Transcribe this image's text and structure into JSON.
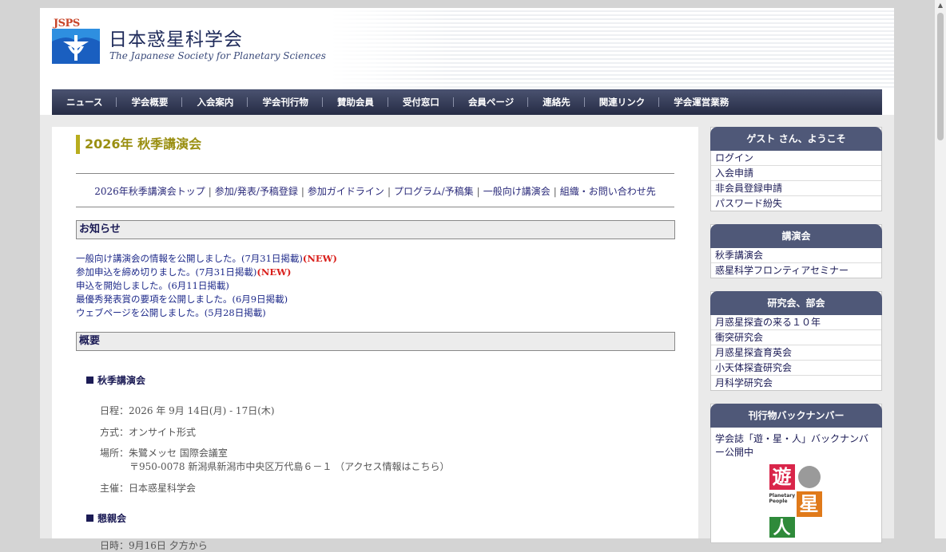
{
  "site": {
    "logo_jsps": "JSPS",
    "title": "日本惑星科学会",
    "subtitle": "The Japanese Society for Planetary Sciences"
  },
  "nav": [
    "ニュース",
    "学会概要",
    "入会案内",
    "学会刊行物",
    "賛助会員",
    "受付窓口",
    "会員ページ",
    "連絡先",
    "関連リンク",
    "学会運営業務"
  ],
  "main": {
    "title": "2026年 秋季講演会",
    "subnav": [
      "2026年秋季講演会トップ",
      "参加/発表/予稿登録",
      "参加ガイドライン",
      "プログラム/予稿集",
      "一般向け講演会",
      "組織・お問い合わせ先"
    ],
    "notice_heading": "お知らせ",
    "notices": [
      {
        "text": "一般向け講演会の情報を公開しました。(7月31日掲載)",
        "badge": "(NEW)"
      },
      {
        "text": "参加申込を締め切りました。(7月31日掲載)",
        "badge": "(NEW)"
      },
      {
        "text": "申込を開始しました。(6月11日掲載)",
        "badge": ""
      },
      {
        "text": "最優秀発表賞の要項を公開しました。(6月9日掲載)",
        "badge": ""
      },
      {
        "text": "ウェブページを公開しました。(5月28日掲載)",
        "badge": ""
      }
    ],
    "overview_heading": "概要",
    "lecture_heading": "秋季講演会",
    "schedule": "日程：2026 年 9月 14日(月) - 17日(木)",
    "format": "方式：オンサイト形式",
    "venue": "場所：朱鷺メッセ 国際会議室",
    "address": "〒950-0078 新潟県新潟市中央区万代島６－１",
    "access_link": "（アクセス情報はこちら）",
    "organizer": "主催：日本惑星科学会",
    "party_heading": "懇親会",
    "party_date": "日時：9月16日 夕方から"
  },
  "sidebar": {
    "welcome": {
      "heading": "ゲスト さん、ようこそ",
      "items": [
        "ログイン",
        "入会申請",
        "非会員登録申請",
        "パスワード紛失"
      ]
    },
    "lectures": {
      "heading": "講演会",
      "items": [
        "秋季講演会",
        "惑星科学フロンティアセミナー"
      ]
    },
    "groups": {
      "heading": "研究会、部会",
      "items": [
        "月惑星探査の来る１０年",
        "衝突研究会",
        "月惑星探査育英会",
        "小天体探査研究会",
        "月科学研究会"
      ]
    },
    "backnumbers": {
      "heading": "刊行物バックナンバー",
      "text": "学会誌「遊・星・人」バックナンバー公開中",
      "cover_chars": [
        "遊",
        "星",
        "人"
      ],
      "cover_caption": "Planetary People"
    }
  },
  "colors": {
    "nav_bg": "#262c45",
    "sidebar_head": "#4f5878",
    "title_accent": "#9a8f12",
    "new_badge": "#d9201c",
    "link": "#1e2a8a"
  }
}
